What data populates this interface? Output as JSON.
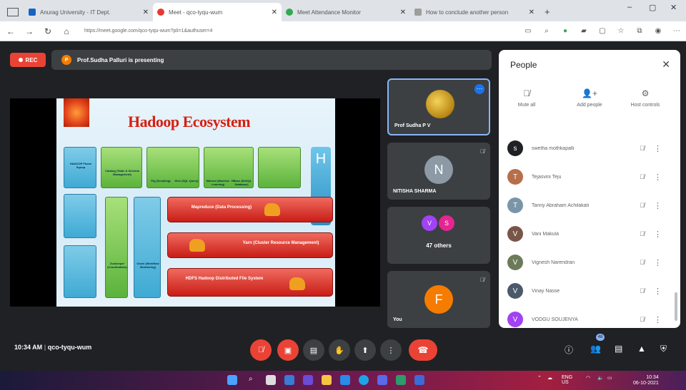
{
  "browser": {
    "tabs": [
      {
        "title": "Anurag University - IT Dept.",
        "active": false,
        "color": "#1565c0"
      },
      {
        "title": "Meet - qco-tyqu-wum",
        "active": true,
        "color": "#e53935"
      },
      {
        "title": "Meet Attendance Monitor",
        "active": false,
        "color": "#34a853"
      },
      {
        "title": "How to conclude another person",
        "active": false,
        "color": "#9e9e9e"
      }
    ],
    "new_tab": "+",
    "url": "https://meet.google.com/qco-tyqu-wum?pli=1&authuser=4",
    "win_min": "–",
    "win_max": "▢",
    "win_close": "✕"
  },
  "meet": {
    "rec_label": "REC",
    "presenter_initial": "P",
    "presenting_text": "Prof.Sudha Palluri is presenting",
    "slide": {
      "title": "Hadoop Ecosystem",
      "boxes": [
        "HADOOP Flume Sqoop",
        "Catalog (Table & Schema Management)",
        "Pig (Scripting)",
        "Hive (SQL Query)",
        "Mahout (Machine Learning)",
        "HBase (NoSQL Database)",
        "Zookeeper (Coordination)",
        "Oozie (Workflow Monitoring)"
      ],
      "bars": [
        "Mapreduce (Data Processing)",
        "Yarn (Cluster Resource Management)",
        "HDFS Hadoop Distributed File System"
      ],
      "h_letter": "H"
    },
    "tiles": [
      {
        "name": "Prof Sudha P V"
      },
      {
        "name": "NITISHA SHARMA",
        "initial": "N",
        "color": "#8d9aa6"
      },
      {
        "others": "47 others",
        "av1": "V",
        "av1_color": "#a142f4",
        "av2": "S",
        "av2_color": "#e52592"
      },
      {
        "name": "You",
        "initial": "F",
        "color": "#f57c00"
      }
    ],
    "time": "10:34 AM",
    "separator": "|",
    "meeting_code": "qco-tyqu-wum",
    "participant_count": "48"
  },
  "people": {
    "title": "People",
    "actions": [
      {
        "icon": "mute-all-icon",
        "label": "Mute all"
      },
      {
        "icon": "add-person-icon",
        "label": "Add people"
      },
      {
        "icon": "host-controls-icon",
        "label": "Host controls"
      }
    ],
    "list": [
      {
        "name": "swetha mothkapalli",
        "initial": "s",
        "color": "#202124"
      },
      {
        "name": "Tejasvini Teju",
        "initial": "T",
        "color": "#b76e4a"
      },
      {
        "name": "Tanny Abraham Achilakati",
        "initial": "T",
        "color": "#7a95a8"
      },
      {
        "name": "Vani Makula",
        "initial": "V",
        "color": "#795548"
      },
      {
        "name": "Vignesh Narendran",
        "initial": "V",
        "color": "#6d7a5a"
      },
      {
        "name": "Vinay Nasse",
        "initial": "V",
        "color": "#4a5a6a"
      },
      {
        "name": "VODGU SOUJENYA",
        "initial": "V",
        "color": "#a142f4"
      }
    ]
  },
  "taskbar": {
    "lang": "ENG",
    "region": "US",
    "clock_time": "10:34",
    "clock_date": "06-10-2021"
  }
}
